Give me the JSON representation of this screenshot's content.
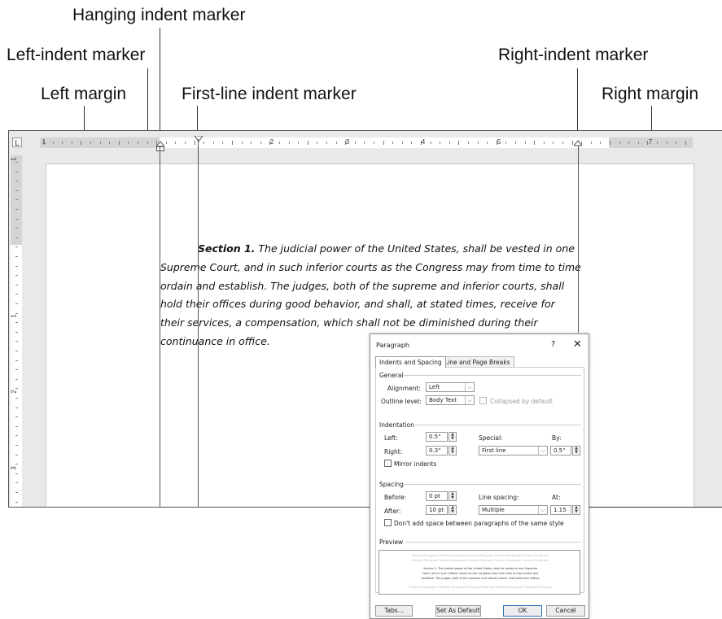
{
  "callouts": {
    "hanging_indent": "Hanging indent marker",
    "left_indent": "Left-indent marker",
    "right_indent": "Right-indent marker",
    "left_margin": "Left margin",
    "first_line_indent": "First-line indent marker",
    "right_margin": "Right margin"
  },
  "ruler": {
    "corner_symbol": "L",
    "horizontal_numbers": [
      "1",
      "1",
      "2",
      "3",
      "4",
      "5",
      "6",
      "7"
    ],
    "vertical_numbers": [
      "1",
      "1",
      "2",
      "3"
    ]
  },
  "document": {
    "section_label": "Section 1.",
    "line1": " The judicial power of the United States, shall be vested in one",
    "line2": "Supreme Court, and in such inferior courts as the Congress may from time to time",
    "line3": "ordain and establish. The judges, both of the supreme and inferior courts, shall",
    "line4": "hold their offices during good behavior, and shall, at stated times, receive for",
    "line5": "their services, a compensation, which shall not be diminished during their",
    "line6": "continuance in office."
  },
  "dialog": {
    "title": "Paragraph",
    "help": "?",
    "close": "✕",
    "tabs": [
      "Indents and Spacing",
      "Line and Page Breaks"
    ],
    "general": {
      "heading": "General",
      "alignment_label": "Alignment:",
      "alignment_value": "Left",
      "outline_label": "Outline level:",
      "outline_value": "Body Text",
      "collapsed_label": "Collapsed by default"
    },
    "indentation": {
      "heading": "Indentation",
      "left_label": "Left:",
      "left_value": "0.5\"",
      "right_label": "Right:",
      "right_value": "0.3\"",
      "special_label": "Special:",
      "special_value": "First line",
      "by_label": "By:",
      "by_value": "0.5\"",
      "mirror_label": "Mirror indents"
    },
    "spacing": {
      "heading": "Spacing",
      "before_label": "Before:",
      "before_value": "0 pt",
      "after_label": "After:",
      "after_value": "10 pt",
      "line_spacing_label": "Line spacing:",
      "line_spacing_value": "Multiple",
      "at_label": "At:",
      "at_value": "1.15",
      "dont_add_label": "Don't add space between paragraphs of the same style"
    },
    "preview": {
      "heading": "Preview",
      "prev1": "Previous Paragraph Previous Paragraph Previous Paragraph Previous Paragraph Previous Paragraph",
      "prev2": "Previous Paragraph Previous Paragraph Previous Paragraph Previous Paragraph Previous Paragraph",
      "sample1": "Section 1. The judicial power of the United States, shall be vested in one Supreme",
      "sample2": "Court, and in such inferior courts as the Congress may from time to time ordain and",
      "sample3": "establish. The judges, both of the supreme and inferior courts, shall hold their offices",
      "follow1": "Following Paragraph Following Paragraph Following Paragraph Following Paragraph Following Paragraph"
    },
    "buttons": {
      "tabs": "Tabs...",
      "set_default": "Set As Default",
      "ok": "OK",
      "cancel": "Cancel"
    }
  }
}
